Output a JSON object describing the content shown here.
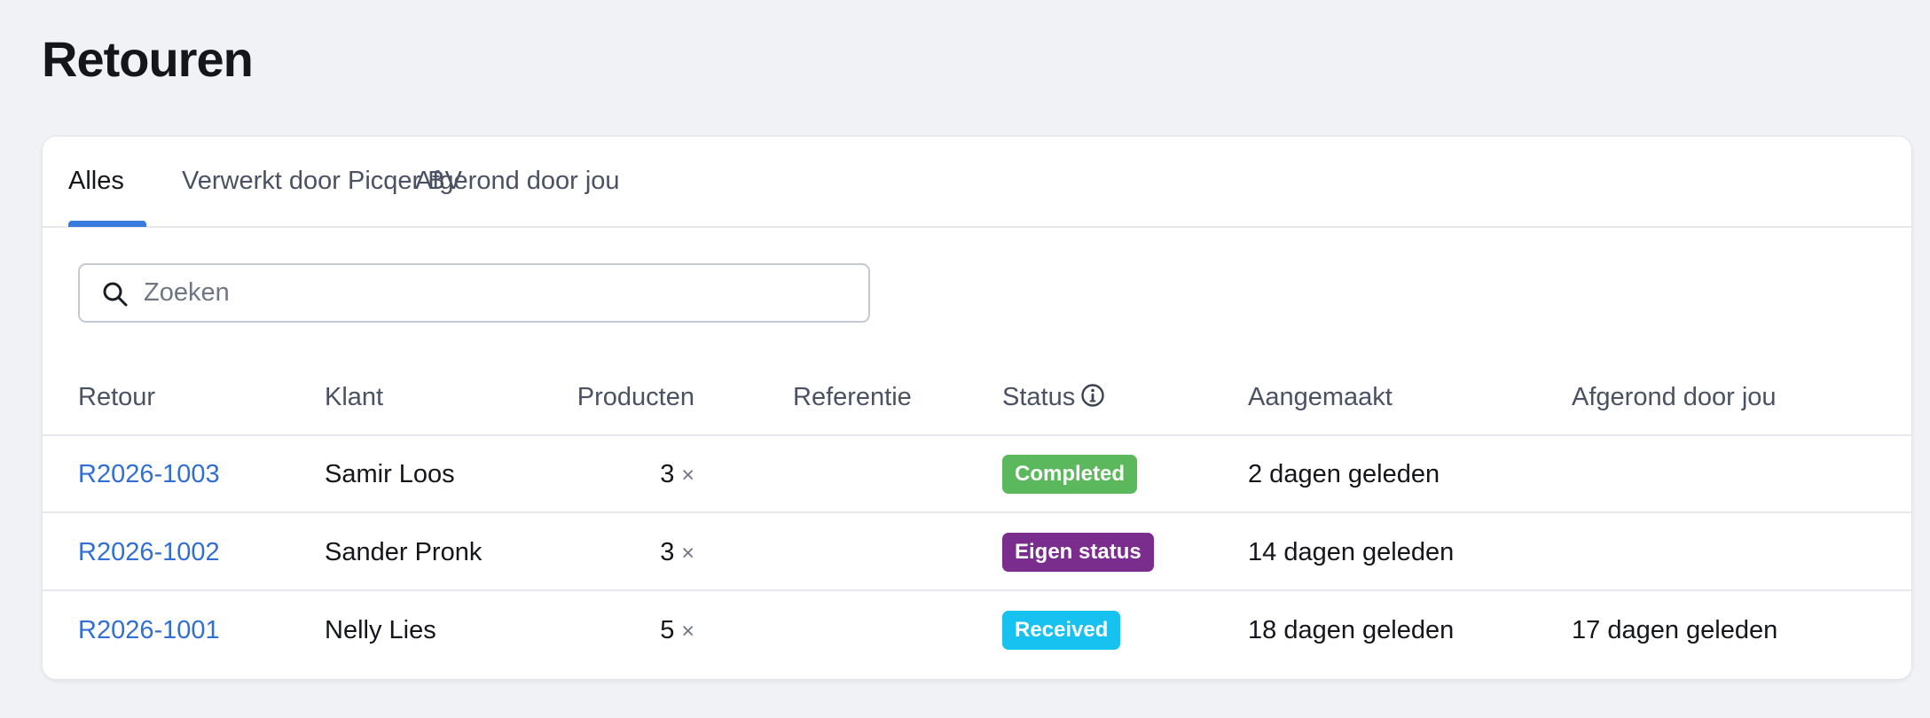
{
  "page": {
    "title": "Retouren"
  },
  "tabs": [
    {
      "label": "Alles",
      "active": true
    },
    {
      "label": "Verwerkt door Picqer BV",
      "active": false
    },
    {
      "label": "Afgerond door jou",
      "active": false
    }
  ],
  "search": {
    "placeholder": "Zoeken",
    "value": "",
    "icon": "search-icon"
  },
  "table": {
    "headers": {
      "retour": "Retour",
      "klant": "Klant",
      "producten": "Producten",
      "referentie": "Referentie",
      "status": "Status",
      "aangemaakt": "Aangemaakt",
      "afgerond": "Afgerond door jou"
    },
    "rows": [
      {
        "retour": "R2026-1003",
        "klant": "Samir Loos",
        "producten": "3",
        "referentie": "",
        "status": "Completed",
        "status_color": "#5cb85c",
        "aangemaakt": "2 dagen geleden",
        "afgerond": ""
      },
      {
        "retour": "R2026-1002",
        "klant": "Sander Pronk",
        "producten": "3",
        "referentie": "",
        "status": "Eigen status",
        "status_color": "#7b2d8e",
        "aangemaakt": "14 dagen geleden",
        "afgerond": ""
      },
      {
        "retour": "R2026-1001",
        "klant": "Nelly Lies",
        "producten": "5",
        "referentie": "",
        "status": "Received",
        "status_color": "#17c1f0",
        "aangemaakt": "18 dagen geleden",
        "afgerond": "17 dagen geleden"
      }
    ],
    "quantity_suffix": "×"
  },
  "colors": {
    "accent": "#3a7be0",
    "link": "#2f6fd6",
    "background": "#f1f2f6"
  }
}
